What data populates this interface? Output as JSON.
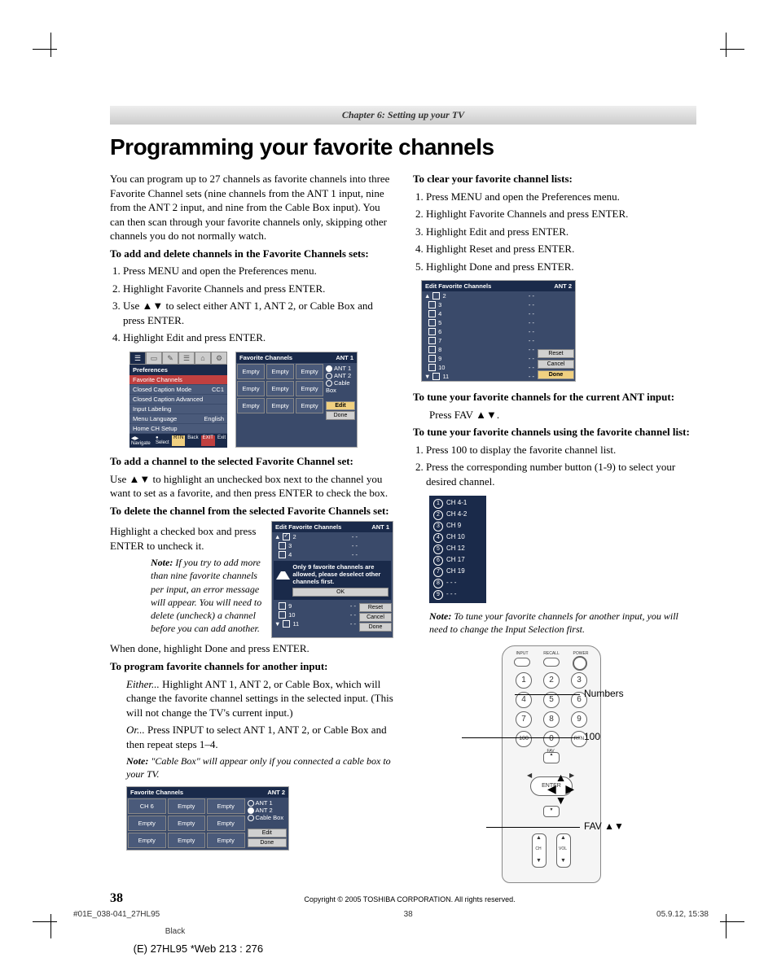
{
  "chapter": "Chapter 6: Setting up your TV",
  "title": "Programming your favorite channels",
  "intro": "You can program up to 27 channels as favorite channels into three Favorite Channel sets (nine channels from the ANT 1 input, nine from the ANT 2 input, and nine from the Cable Box input). You can then scan through your favorite channels only, skipping other channels you do not normally watch.",
  "h_add_delete": "To add and delete channels in the Favorite Channels sets:",
  "steps_a": {
    "s1": "Press MENU and open the Preferences menu.",
    "s2": "Highlight Favorite Channels and press ENTER.",
    "s3a": "Use ",
    "s3b": " to select either ANT 1, ANT 2, or Cable Box and press ENTER.",
    "s4": "Highlight Edit and press ENTER."
  },
  "arrows_ud": "▲▼",
  "h_add_channel": "To add a channel to the selected Favorite Channel set:",
  "p_add_a": "Use ",
  "p_add_b": " to highlight an unchecked box next to the channel you want to set as a favorite, and then press ENTER to check the box.",
  "h_delete_channel": "To delete the channel from the selected Favorite Channels set:",
  "p_delete": "Highlight a checked box and press ENTER to uncheck it.",
  "note1_label": "Note:",
  "note1_text": " If you try to add more than nine favorite channels per input, an error message will appear. You will need to delete (uncheck) a channel before you can add another.",
  "p_done": "When done, highlight Done and press ENTER.",
  "h_program_another": "To program favorite channels for another input:",
  "p_either_lead": "Either...",
  "p_either": " Highlight ANT 1, ANT 2, or Cable Box, which will change the favorite channel settings in the selected input. (This will not change the TV's current input.)",
  "p_or_lead": "Or...",
  "p_or": " Press INPUT to select ANT 1, ANT 2, or Cable Box and then repeat steps 1–4.",
  "note2_label": "Note:",
  "note2_text": " \"Cable Box\" will appear only if you connected a cable box to your TV.",
  "h_clear": "To clear your favorite channel lists:",
  "steps_clear": {
    "s1": "Press MENU and open the Preferences menu.",
    "s2": "Highlight Favorite Channels and press ENTER.",
    "s3": "Highlight Edit and press ENTER.",
    "s4": "Highlight Reset and press ENTER.",
    "s5": "Highlight Done and press ENTER."
  },
  "h_tune_current": "To tune your favorite channels for the current ANT input:",
  "p_tune_current_a": "Press FAV ",
  "p_tune_current_b": ".",
  "h_tune_list": "To tune your favorite channels using the favorite channel list:",
  "steps_tune": {
    "s1": "Press 100 to display the favorite channel list.",
    "s2": "Press the corresponding number button (1-9) to select your desired channel."
  },
  "note3_label": "Note:",
  "note3_text": " To tune your favorite channels for another input, you will need to change the Input Selection first.",
  "osd_pref": {
    "title": "Preferences",
    "items": {
      "i0": "Favorite Channels",
      "i1": "Closed Caption Mode",
      "i1v": "CC1",
      "i2": "Closed Caption Advanced",
      "i3": "Input Labeling",
      "i4": "Menu Language",
      "i4v": "English",
      "i5": "Home CH Setup"
    },
    "bar": {
      "nav": "Navigate",
      "sel": "Select",
      "back": "Back",
      "exit": "Exit"
    }
  },
  "osd_fav1": {
    "title": "Favorite Channels",
    "ant": "ANT 1",
    "empty": "Empty",
    "radios": {
      "a1": "ANT 1",
      "a2": "ANT 2",
      "cb": "Cable Box"
    },
    "edit": "Edit",
    "done": "Done"
  },
  "osd_fav2": {
    "title": "Favorite Channels",
    "ant": "ANT 2",
    "ch6": "CH 6",
    "empty": "Empty",
    "radios": {
      "a1": "ANT 1",
      "a2": "ANT 2",
      "cb": "Cable Box"
    },
    "edit": "Edit",
    "done": "Done"
  },
  "osd_edit1": {
    "title": "Edit Favorite Channels",
    "ant": "ANT 1",
    "rows": {
      "r1": "2",
      "r2": "3",
      "r3": "4",
      "r4": "9",
      "r5": "10",
      "r6": "11"
    },
    "dash": "- -",
    "warn": "Only 9 favorite channels are allowed, please deselect other channels first.",
    "ok": "OK",
    "reset": "Reset",
    "cancel": "Cancel",
    "done": "Done"
  },
  "osd_edit2": {
    "title": "Edit Favorite Channels",
    "ant": "ANT 2",
    "rows": {
      "r1": "2",
      "r2": "3",
      "r3": "4",
      "r4": "5",
      "r5": "6",
      "r6": "7",
      "r7": "8",
      "r8": "9",
      "r9": "10",
      "r10": "11"
    },
    "dash": "- -",
    "reset": "Reset",
    "cancel": "Cancel",
    "done": "Done"
  },
  "fav_list": {
    "r1": "CH 4-1",
    "r2": "CH 4-2",
    "r3": "CH 9",
    "r4": "CH 10",
    "r5": "CH 12",
    "r6": "CH 17",
    "r7": "CH 19",
    "r8": "- - -",
    "r9": "- - -"
  },
  "remote": {
    "input": "INPUT",
    "recall": "RECALL",
    "power": "POWER",
    "n1": "1",
    "n2": "2",
    "n3": "3",
    "n4": "4",
    "n5": "5",
    "n6": "6",
    "n7": "7",
    "n8": "8",
    "n9": "9",
    "n0": "0",
    "hundred": "100",
    "rtn": "RTN",
    "enter": "ENTER",
    "fav": "FAV",
    "ch": "CH",
    "vol": "VOL",
    "callout_numbers": "Numbers",
    "callout_100": "100",
    "callout_fav": "FAV ▲▼"
  },
  "footer": {
    "page": "38",
    "copyright": "Copyright © 2005 TOSHIBA CORPORATION. All rights reserved.",
    "file": "#01E_038-041_27HL95",
    "pg": "38",
    "date": "05.9.12, 15:38",
    "black": "Black",
    "web": "(E) 27HL95 *Web 213 : 276"
  }
}
